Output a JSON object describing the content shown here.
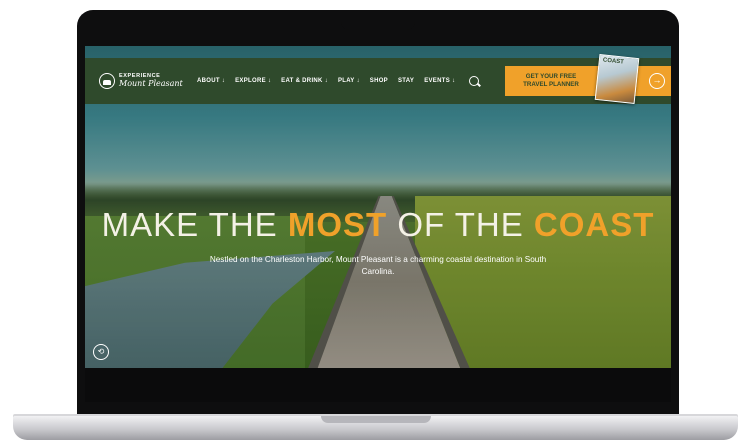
{
  "nav": {
    "logo_top": "EXPERIENCE",
    "logo_bottom": "Mount Pleasant",
    "items": [
      {
        "label": "ABOUT ↓"
      },
      {
        "label": "EXPLORE ↓"
      },
      {
        "label": "EAT & DRINK ↓"
      },
      {
        "label": "PLAY ↓"
      },
      {
        "label": "SHOP"
      },
      {
        "label": "STAY"
      },
      {
        "label": "EVENTS ↓"
      }
    ],
    "cta_line1": "GET YOUR FREE",
    "cta_line2": "TRAVEL PLANNER",
    "guide_label": "COAST",
    "cta_arrow": "→"
  },
  "hero": {
    "headline_1": "MAKE THE ",
    "headline_accent_1": "MOST",
    "headline_2": " OF THE ",
    "headline_accent_2": "COAST",
    "subtitle": "Nestled on the Charleston Harbor, Mount Pleasant is a charming coastal destination in South Carolina.",
    "play_icon": "⟲"
  },
  "colors": {
    "nav_bg": "#2f4a2c",
    "accent": "#f0a12a",
    "text_light": "#f4f1e6"
  }
}
